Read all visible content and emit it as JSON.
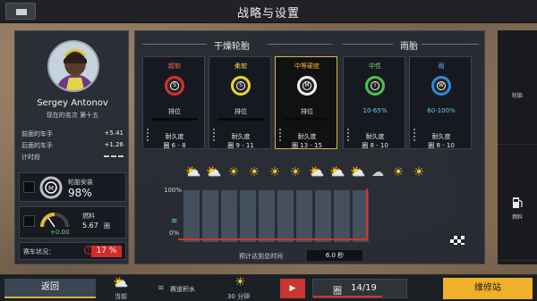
{
  "header": {
    "title": "战略与设置"
  },
  "driver": {
    "name": "Sergey Antonov",
    "position_label": "现在的名次",
    "position_value": "第十五",
    "stats": [
      {
        "label": "前面的车手",
        "value": "+5.41"
      },
      {
        "label": "后面的车手",
        "value": "+1.26"
      },
      {
        "label": "计时段",
        "value": ""
      }
    ],
    "tyre_fitted": {
      "label": "轮胎安装",
      "value": "98%"
    },
    "fuel": {
      "label": "燃料",
      "value": "5.67",
      "unit": "圈",
      "delta": "+0.00"
    },
    "car_status": {
      "label": "赛车状况：",
      "value": "17 %"
    }
  },
  "sections": {
    "dry": "干燥轮胎",
    "wet": "雨胎"
  },
  "tyres": [
    {
      "name": "超软",
      "symbol": "S",
      "ring": "#d9302f",
      "name_color": "#ff6a5c",
      "field": "排位",
      "durability_label": "耐久度",
      "range": "圈 6 - 8",
      "selected": false,
      "water": false
    },
    {
      "name": "柔软",
      "symbol": "S",
      "ring": "#e9d52d",
      "name_color": "#ffe24a",
      "field": "排位",
      "durability_label": "耐久度",
      "range": "圈 9 - 11",
      "selected": false,
      "water": false
    },
    {
      "name": "中等硬度",
      "symbol": "M",
      "ring": "#f0f0f0",
      "name_color": "#f4b32a",
      "field": "排位",
      "durability_label": "耐久度",
      "range": "圈 13 - 15",
      "selected": true,
      "water": false
    },
    {
      "name": "中性",
      "symbol": "I",
      "ring": "#49c24a",
      "name_color": "#7ad07a",
      "field": "10-65%",
      "durability_label": "耐久度",
      "range": "圈 8 - 10",
      "selected": false,
      "water": true
    },
    {
      "name": "雨",
      "symbol": "W",
      "ring": "#2f8ad9",
      "name_color": "#67b4ee",
      "field": "60-100%",
      "durability_label": "耐久度",
      "range": "圈 8 - 10",
      "selected": false,
      "water": true
    }
  ],
  "forecast": {
    "icons": [
      "partly-sunny-icon",
      "partly-sunny-icon",
      "sun-icon",
      "sun-icon",
      "sun-icon",
      "sun-icon",
      "partly-sunny-icon",
      "partly-sunny-icon",
      "partly-sunny-icon",
      "cloudy-icon",
      "sun-icon",
      "sun-icon"
    ],
    "y_top": "100%",
    "y_bottom": "0%",
    "eta_label": "预计达到总时间",
    "eta_value": "6.0 秒"
  },
  "right_strip": {
    "top_label": "轮胎",
    "bottom_label": "燃料"
  },
  "bottom": {
    "return_label": "返回",
    "weather_label": "当前",
    "water_label": "赛道积水",
    "time_label": "30 分钟",
    "lap_label": "圈",
    "lap_value": "14/19",
    "lap_fraction": 0.737,
    "pit_label": "维修站"
  },
  "colors": {
    "accent_yellow": "#f0b02a",
    "danger_red": "#d9302f",
    "water_blue": "#6ec3ee"
  }
}
